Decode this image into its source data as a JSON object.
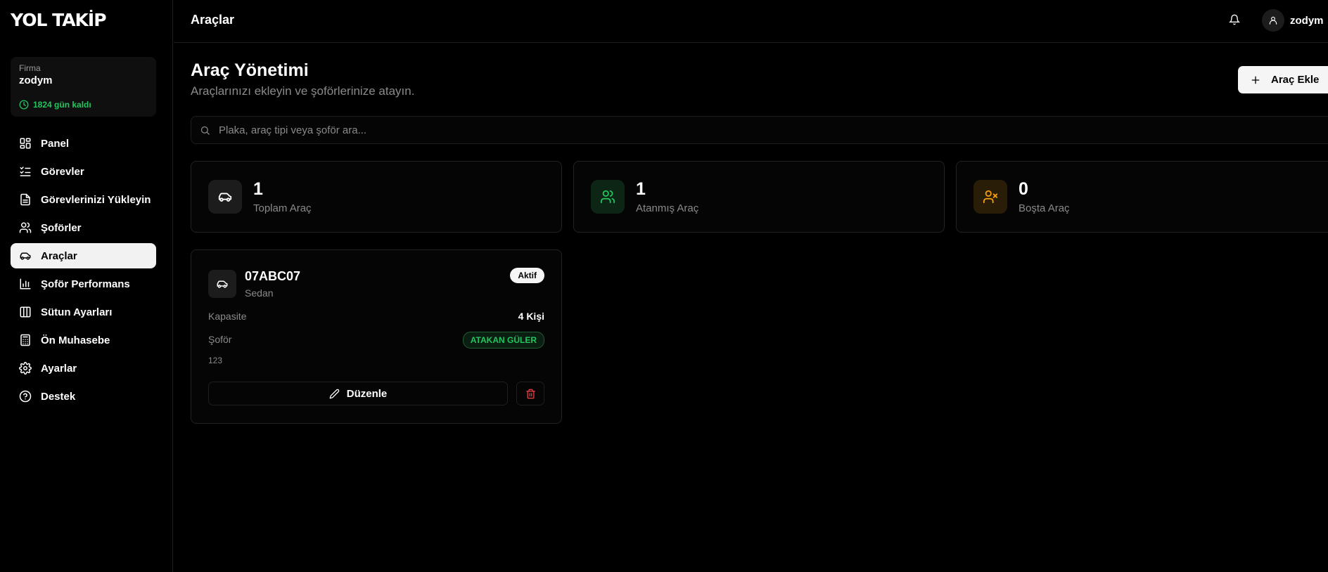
{
  "app": {
    "logo": "YOL TAKİP"
  },
  "company": {
    "label": "Firma",
    "name": "zodym",
    "days_left": "1824 gün kaldı"
  },
  "sidebar": {
    "items": [
      {
        "label": "Panel",
        "icon": "layout-dashboard-icon",
        "active": false
      },
      {
        "label": "Görevler",
        "icon": "list-checks-icon",
        "active": false
      },
      {
        "label": "Görevlerinizi Yükleyin",
        "icon": "file-text-icon",
        "active": false
      },
      {
        "label": "Şoförler",
        "icon": "users-icon",
        "active": false
      },
      {
        "label": "Araçlar",
        "icon": "car-icon",
        "active": true
      },
      {
        "label": "Şoför Performans",
        "icon": "bar-chart-icon",
        "active": false
      },
      {
        "label": "Sütun Ayarları",
        "icon": "columns-icon",
        "active": false
      },
      {
        "label": "Ön Muhasebe",
        "icon": "calculator-icon",
        "active": false
      },
      {
        "label": "Ayarlar",
        "icon": "gear-icon",
        "active": false
      },
      {
        "label": "Destek",
        "icon": "help-circle-icon",
        "active": false
      }
    ]
  },
  "header": {
    "title": "Araçlar",
    "username": "zodym"
  },
  "page": {
    "title": "Araç Yönetimi",
    "subtitle": "Araçlarınızı ekleyin ve şoförlerinize atayın.",
    "add_button": "Araç Ekle"
  },
  "search": {
    "placeholder": "Plaka, araç tipi veya şoför ara...",
    "value": ""
  },
  "stats": [
    {
      "value": "1",
      "label": "Toplam Araç",
      "icon": "car-icon",
      "color": "#ffffff"
    },
    {
      "value": "1",
      "label": "Atanmış Araç",
      "icon": "users-icon",
      "color": "#22c55e"
    },
    {
      "value": "0",
      "label": "Boşta Araç",
      "icon": "user-x-icon",
      "color": "#f59e0b"
    }
  ],
  "vehicles": [
    {
      "plate": "07ABC07",
      "type": "Sedan",
      "status": "Aktif",
      "capacity_label": "Kapasite",
      "capacity": "4 Kişi",
      "driver_label": "Şoför",
      "driver": "ATAKAN GÜLER",
      "note": "123",
      "edit_label": "Düzenle"
    }
  ],
  "colors": {
    "accent_green": "#22c55e",
    "accent_orange": "#f59e0b",
    "danger": "#ef4444"
  }
}
